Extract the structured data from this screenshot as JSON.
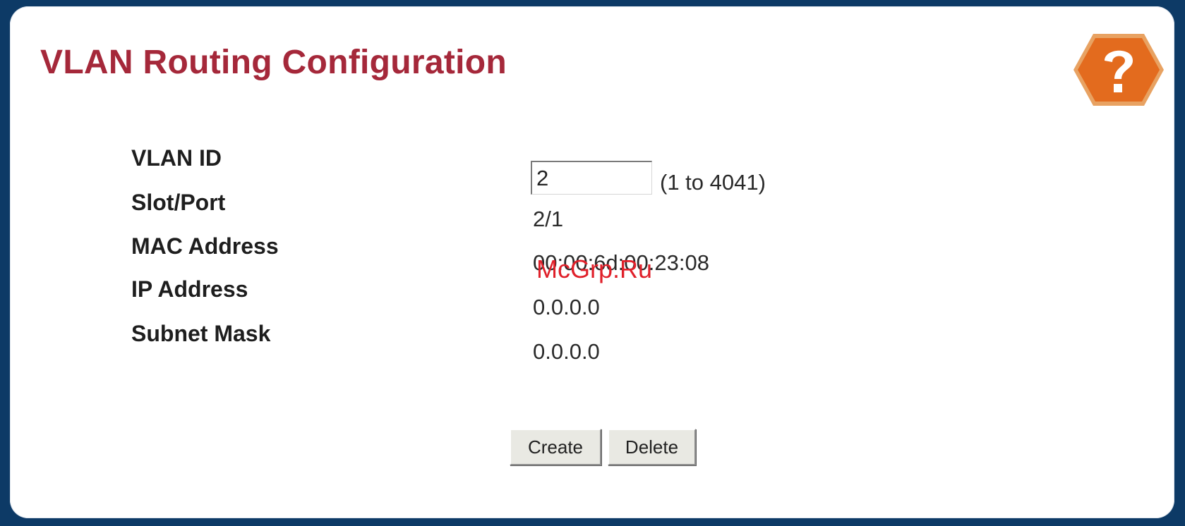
{
  "page": {
    "title": "VLAN Routing Configuration",
    "help_icon": "help-icon"
  },
  "form": {
    "vlan_id": {
      "label": "VLAN ID",
      "value": "2",
      "range_hint": "(1 to 4041)"
    },
    "slot_port": {
      "label": "Slot/Port",
      "value": "2/1"
    },
    "mac_address": {
      "label": "MAC Address",
      "value": "00:00:6d:00:23:08"
    },
    "ip_address": {
      "label": "IP Address",
      "value": "0.0.0.0"
    },
    "subnet_mask": {
      "label": "Subnet Mask",
      "value": "0.0.0.0"
    }
  },
  "buttons": {
    "create_label": "Create",
    "delete_label": "Delete"
  },
  "watermark": "McGrp.Ru",
  "colors": {
    "frame": "#0d3a66",
    "title": "#a5283a",
    "help_icon_fill": "#e36b1e",
    "watermark": "#e0202a"
  }
}
